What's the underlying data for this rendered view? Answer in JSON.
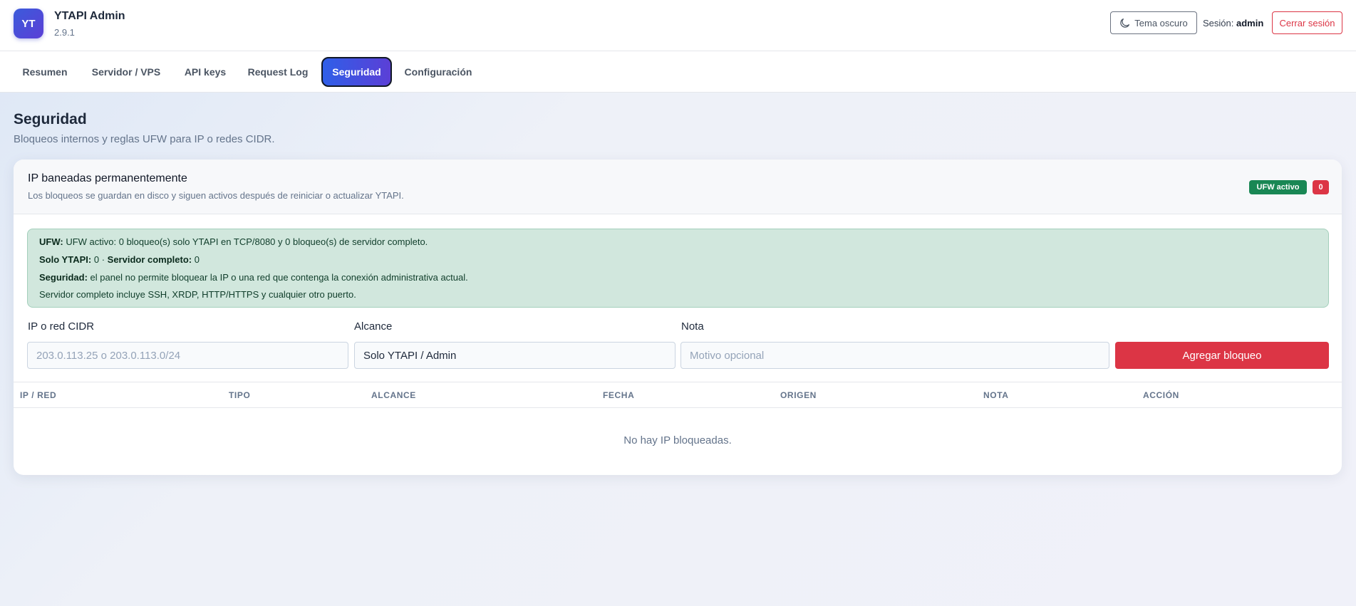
{
  "header": {
    "logo_text": "YT",
    "app_title": "YTAPI Admin",
    "version": "2.9.1",
    "theme_button": "Tema oscuro",
    "session_label": "Sesión:",
    "session_user": "admin",
    "logout_button": "Cerrar sesión"
  },
  "nav": {
    "tabs": [
      {
        "label": "Resumen",
        "active": false
      },
      {
        "label": "Servidor / VPS",
        "active": false
      },
      {
        "label": "API keys",
        "active": false
      },
      {
        "label": "Request Log",
        "active": false
      },
      {
        "label": "Seguridad",
        "active": true
      },
      {
        "label": "Configuración",
        "active": false
      }
    ]
  },
  "page": {
    "title": "Seguridad",
    "subtitle": "Bloqueos internos y reglas UFW para IP o redes CIDR."
  },
  "card": {
    "title": "IP baneadas permanentemente",
    "description": "Los bloqueos se guardan en disco y siguen activos después de reiniciar o actualizar YTAPI.",
    "badge_status": "UFW activo",
    "badge_count": "0"
  },
  "alert": {
    "ufw_label": "UFW:",
    "ufw_text": "UFW activo: 0 bloqueo(s) solo YTAPI en TCP/8080 y 0 bloqueo(s) de servidor completo.",
    "solo_label": "Solo YTAPI:",
    "solo_value": "0",
    "separator": "·",
    "server_label": "Servidor completo:",
    "server_value": "0",
    "security_label": "Seguridad:",
    "security_text": "el panel no permite bloquear la IP o una red que contenga la conexión administrativa actual.",
    "note_text": "Servidor completo incluye SSH, XRDP, HTTP/HTTPS y cualquier otro puerto."
  },
  "form": {
    "ip_label": "IP o red CIDR",
    "ip_placeholder": "203.0.113.25 o 203.0.113.0/24",
    "scope_label": "Alcance",
    "scope_value": "Solo YTAPI / Admin",
    "note_label": "Nota",
    "note_placeholder": "Motivo opcional",
    "add_button": "Agregar bloqueo"
  },
  "table": {
    "columns": [
      "IP / RED",
      "TIPO",
      "ALCANCE",
      "FECHA",
      "ORIGEN",
      "NOTA",
      "ACCIÓN"
    ],
    "empty_message": "No hay IP bloqueadas."
  },
  "colors": {
    "accent": "#3b5bdb",
    "danger": "#dc3545",
    "success": "#198754",
    "alert_bg": "#d1e7dd"
  },
  "icons": {
    "theme": "moon-icon"
  }
}
